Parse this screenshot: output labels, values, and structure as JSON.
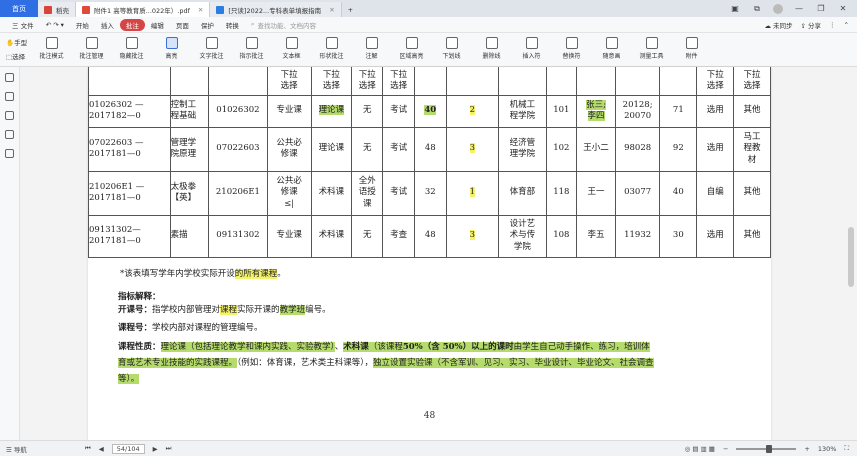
{
  "tabs": {
    "home": "首页",
    "items": [
      {
        "label": "稻壳",
        "color": "#d9443a",
        "active": false
      },
      {
        "label": "附件1 高等教育质...022年）.pdf",
        "color": "#e04a3a",
        "active": true
      },
      {
        "label": "[只读]2022...专科表单填报指南",
        "color": "#2b7de1",
        "active": false
      }
    ]
  },
  "menubar": {
    "file": "三 文件",
    "items": [
      "开始",
      "插入",
      "批注",
      "编辑",
      "页面",
      "保护",
      "转换"
    ],
    "active_index": 2,
    "search": "查找功能、文档内容",
    "right": [
      "未同步",
      "分享"
    ]
  },
  "ribbon": {
    "left": [
      "手型",
      "选择"
    ],
    "buttons": [
      "批注模式",
      "批注管理",
      "隐藏批注",
      "高亮",
      "文字批注",
      "指示批注",
      "文本框",
      "形状批注",
      "注解",
      "区域高亮",
      "下划线",
      "删除线",
      "插入符",
      "替换符",
      "随意画",
      "测量工具",
      "附件"
    ],
    "selected_index": 3
  },
  "table": {
    "partial_header": [
      "下拉\n选择",
      "下拉\n选择",
      "下拉\n选择",
      "下拉\n选择",
      "下拉\n选择",
      "下拉\n选择"
    ],
    "rows": [
      {
        "code": "01026302 —\n2017182—0",
        "name": "控制工\n程基础",
        "cid": "01026302",
        "cat": "专业课",
        "type": "理论课",
        "exp": "无",
        "exam": "考试",
        "hours": "40",
        "credit": "2",
        "dept": "机械工\n程学院",
        "room": "101",
        "teacher": "张三;\n李四",
        "tno": "20128;\n20070",
        "num": "71",
        "sel": "选用",
        "book": "其他"
      },
      {
        "code": "07022603 —\n2017181—0",
        "name": "管理学\n院原理",
        "cid": "07022603",
        "cat": "公共必\n修课",
        "type": "理论课",
        "exp": "无",
        "exam": "考试",
        "hours": "48",
        "credit": "3",
        "dept": "经济管\n理学院",
        "room": "102",
        "teacher": "王小二",
        "tno": "98028",
        "num": "92",
        "sel": "选用",
        "book": "马工\n程教\n材"
      },
      {
        "code": "210206E1 —\n2017181—0",
        "name": "太极拳\n【英】",
        "cid": "210206E1",
        "cat": "公共必\n修课\n≤|",
        "type": "术科课",
        "exp": "全外\n语授\n课",
        "exam": "考试",
        "hours": "32",
        "credit": "1",
        "dept": "体育部",
        "room": "118",
        "teacher": "王一",
        "tno": "03077",
        "num": "40",
        "sel": "自编",
        "book": "其他"
      },
      {
        "code": "09131302—\n2017181—0",
        "name": "素描",
        "cid": "09131302",
        "cat": "专业课",
        "type": "术科课",
        "exp": "无",
        "exam": "考查",
        "hours": "48",
        "credit": "3",
        "dept": "设计艺\n术与传\n学院",
        "room": "108",
        "teacher": "李五",
        "tno": "11932",
        "num": "30",
        "sel": "选用",
        "book": "其他"
      }
    ]
  },
  "notes": {
    "star": "*该表填写学年内学校实际开设的所有课程。",
    "star_hl": "的所有课程",
    "heading": "指标解释：",
    "kaike_label": "开课号：",
    "kaike_text_1": "指学校内部管理对",
    "kaike_hl1": "课程",
    "kaike_text_2": "实际开课的",
    "kaike_hl2": "教学班",
    "kaike_text_3": "编号。",
    "kch_label": "课程号：",
    "kch_text": "学校内部对课程的管理编号。",
    "xz_label": "课程性质：",
    "xz_hl1": "理论课（包括理论教学和课内实践、实验教学）",
    "xz_sep": "、",
    "xz_hl2_bold": "术科课",
    "xz_p1": "（该课程",
    "xz_bold2": "50%（含 50%）以上的课时",
    "xz_p2": "由学生自己动手操作、练习，培训体",
    "xz_p3": "育或艺术专业技能的实践课程。",
    "xz_plain": "（例如：体育课，艺术类主科课等），",
    "xz_hl3": "独立设置实验课",
    "xz_p4": "（不含军训、见习、实习、毕业设计、毕业论文、社会调查",
    "xz_p5": "等）。"
  },
  "page_number": "48",
  "status": {
    "nav": "导航",
    "page": "54/104",
    "zoom": "130%"
  }
}
